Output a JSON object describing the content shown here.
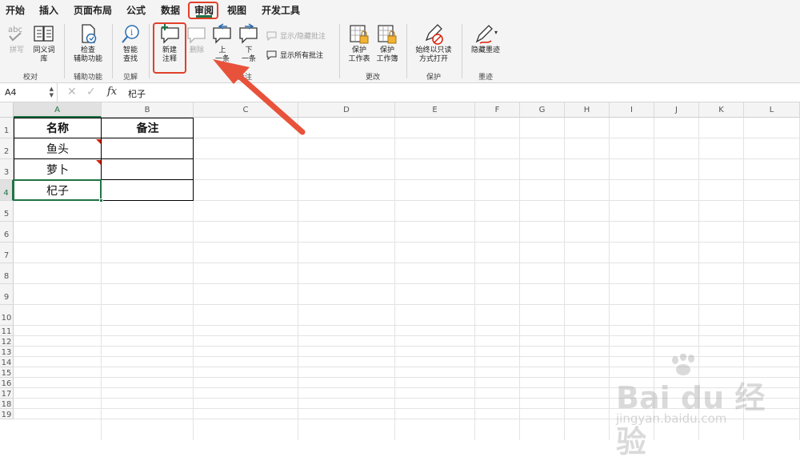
{
  "menu": {
    "tabs": [
      "开始",
      "插入",
      "页面布局",
      "公式",
      "数据",
      "审阅",
      "视图",
      "开发工具"
    ],
    "active_tab": "审阅"
  },
  "ribbon": {
    "spelling": "拼写",
    "thesaurus": "同义词\n库",
    "accessibility": "检查\n辅助功能",
    "smart_lookup": "智能\n查找",
    "new_comment": "新建\n注释",
    "delete": "删除",
    "previous": "上\n一条",
    "next": "下\n一条",
    "show_hide_comment": "显示/隐藏批注",
    "show_all_comments": "显示所有批注",
    "protect_sheet": "保护\n工作表",
    "protect_workbook": "保护\n工作簿",
    "always_open_readonly": "始终以只读\n方式打开",
    "hide_ink": "隐藏墨迹",
    "groups": {
      "proofing": "校对",
      "accessibility": "辅助功能",
      "insights": "见解",
      "comments": "批注",
      "changes": "更改",
      "protect": "保护",
      "ink": "墨迹"
    }
  },
  "formula_bar": {
    "name_box": "A4",
    "fx": "fx",
    "content": "杞子"
  },
  "sheet": {
    "columns": [
      "A",
      "B",
      "C",
      "D",
      "E",
      "F",
      "G",
      "H",
      "I",
      "J",
      "K",
      "L"
    ],
    "rows": [
      "1",
      "2",
      "3",
      "4",
      "5",
      "6",
      "7",
      "8",
      "9",
      "10",
      "11",
      "12",
      "13",
      "14",
      "15",
      "16",
      "17",
      "18",
      "19"
    ],
    "selected_cell": "A4",
    "table": {
      "headers": [
        "名称",
        "备注"
      ],
      "rows": [
        [
          "鱼头",
          ""
        ],
        [
          "萝卜",
          ""
        ],
        [
          "杞子",
          ""
        ]
      ],
      "comments_on": [
        "A2",
        "A3"
      ]
    }
  },
  "colors": {
    "accent": "#217346",
    "highlight": "#e0402a",
    "comment_mark": "#d81e06"
  },
  "watermark": {
    "logo": "Bai du 经验",
    "url": "jingyan.baidu.com"
  }
}
